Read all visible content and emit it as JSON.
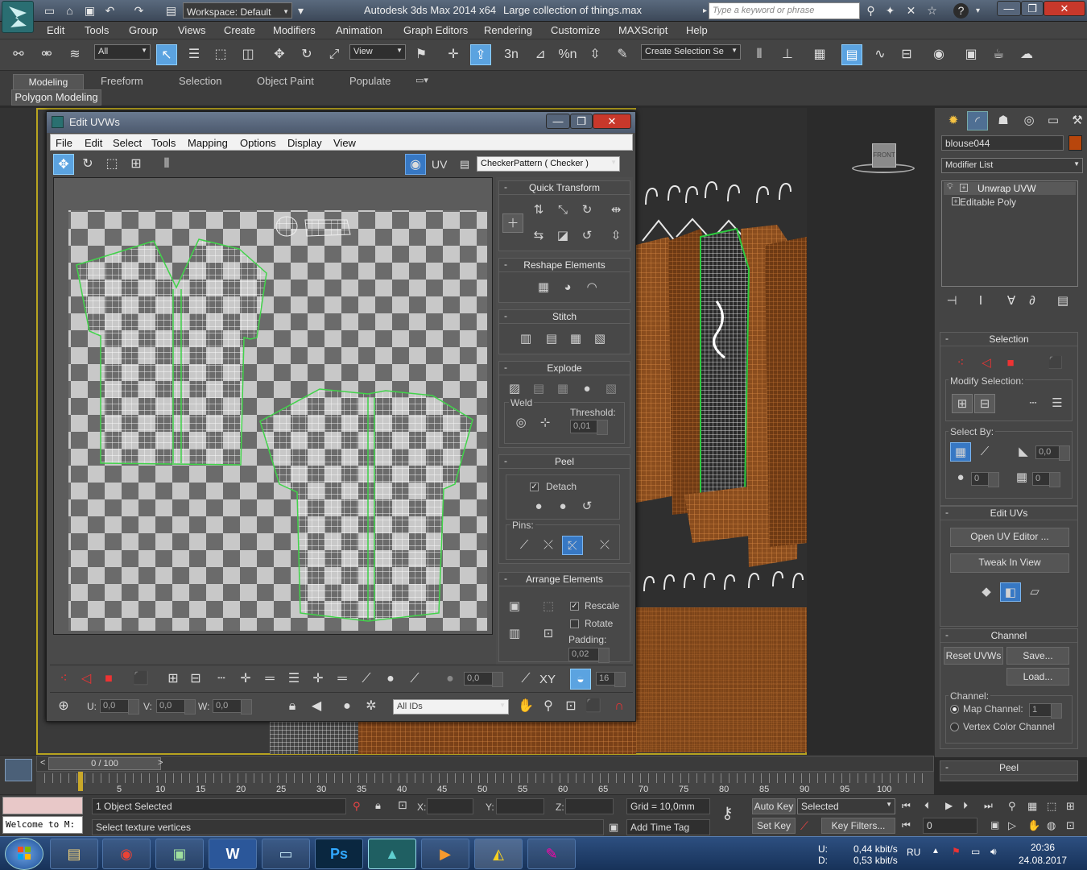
{
  "titlebar": {
    "workspace": "Workspace: Default",
    "app_title": "Autodesk 3ds Max  2014 x64",
    "file_title": "Large collection of things.max",
    "search_placeholder": "Type a keyword or phrase",
    "help_label": "?"
  },
  "menubar": [
    "Edit",
    "Tools",
    "Group",
    "Views",
    "Create",
    "Modifiers",
    "Animation",
    "Graph Editors",
    "Rendering",
    "Customize",
    "MAXScript",
    "Help"
  ],
  "toolbar": {
    "filter": "All",
    "ref_coord": "View",
    "selection_set": "Create Selection Se",
    "snap_label": "3n",
    "angle_snap": "%n"
  },
  "ribbon": {
    "tabs": [
      "Modeling",
      "Freeform",
      "Selection",
      "Object Paint",
      "Populate"
    ],
    "sub_label": "Polygon Modeling"
  },
  "viewcube_label": "FRONT",
  "uvw": {
    "title": "Edit UVWs",
    "menu": [
      "File",
      "Edit",
      "Select",
      "Tools",
      "Mapping",
      "Options",
      "Display",
      "View"
    ],
    "uv_label": "UV",
    "texture": "CheckerPattern  ( Checker )",
    "groups": {
      "quick_transform": "Quick Transform",
      "reshape": "Reshape Elements",
      "stitch": "Stitch",
      "explode": "Explode",
      "weld": "Weld",
      "threshold_label": "Threshold:",
      "threshold": "0,01",
      "peel": "Peel",
      "detach": "Detach",
      "pins": "Pins:",
      "arrange": "Arrange Elements",
      "rescale": "Rescale",
      "rotate": "Rotate",
      "padding_label": "Padding:",
      "padding": "0,02"
    },
    "bottom": {
      "value1": "0,0",
      "xy": "XY",
      "value2": "16",
      "u_label": "U:",
      "u": "0,0",
      "v_label": "V:",
      "v": "0,0",
      "w_label": "W:",
      "w": "0,0",
      "ids": "All IDs"
    }
  },
  "command_panel": {
    "object_name": "blouse044",
    "object_color": "#b8460c",
    "modifier_list": "Modifier List",
    "stack": [
      "Unwrap UVW",
      "Editable Poly"
    ],
    "selection": "Selection",
    "modify_selection": "Modify Selection:",
    "select_by": "Select By:",
    "sb_val1": "0,0",
    "sb_val2": "0",
    "sb_val3": "0",
    "edit_uvs": "Edit UVs",
    "open_uv_editor": "Open UV Editor ...",
    "tweak_in_view": "Tweak In View",
    "channel": "Channel",
    "reset_uvws": "Reset UVWs",
    "save": "Save...",
    "load": "Load...",
    "channel_label": "Channel:",
    "map_channel": "Map Channel:",
    "map_channel_value": "1",
    "vertex_color_channel": "Vertex Color Channel",
    "peel": "Peel"
  },
  "timeline": {
    "frame": "0 / 100",
    "ticks": [
      "5",
      "10",
      "15",
      "20",
      "25",
      "30",
      "35",
      "40",
      "45",
      "50",
      "55",
      "60",
      "65",
      "70",
      "75",
      "80",
      "85",
      "90",
      "95",
      "100"
    ]
  },
  "status": {
    "welcome": "Welcome to M:",
    "selected_count": "1 Object Selected",
    "prompt": "Select texture vertices",
    "x_label": "X:",
    "y_label": "Y:",
    "z_label": "Z:",
    "grid": "Grid = 10,0mm",
    "add_time_tag": "Add Time Tag",
    "auto_key": "Auto Key",
    "selected": "Selected",
    "set_key": "Set Key",
    "key_filters": "Key Filters...",
    "frame_value": "0"
  },
  "taskbar": {
    "net_u": "U:",
    "net_u_val": "0,44 kbit/s",
    "net_d": "D:",
    "net_d_val": "0,53 kbit/s",
    "lang": "RU",
    "time": "20:36",
    "date": "24.08.2017",
    "ps_label": "Ps",
    "word_label": "W"
  }
}
